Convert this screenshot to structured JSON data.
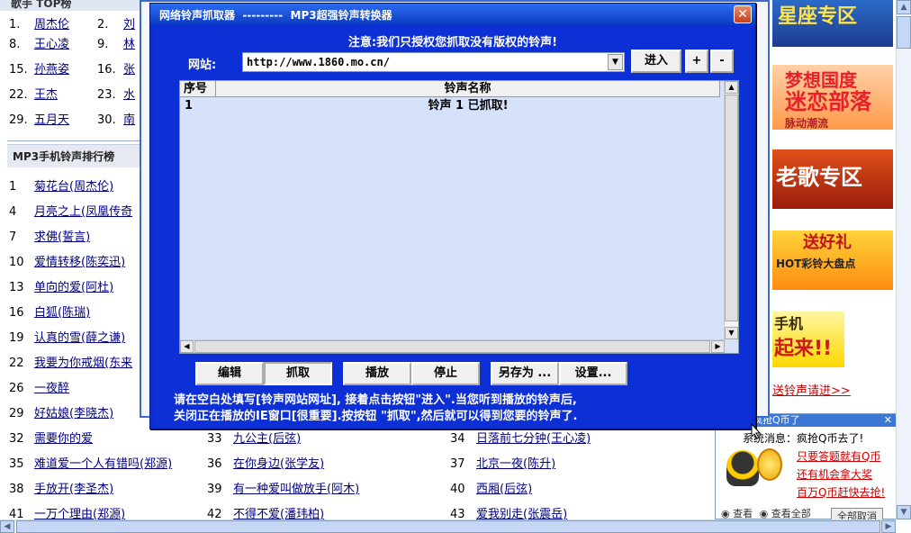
{
  "page": {
    "top_header": "歌手 TOP榜",
    "singers": [
      {
        "num": "1.",
        "name": "周杰伦"
      },
      {
        "num": "2.",
        "name": "刘"
      },
      {
        "num": "8.",
        "name": "王心凌"
      },
      {
        "num": "9.",
        "name": "林"
      },
      {
        "num": "15.",
        "name": "孙燕姿"
      },
      {
        "num": "16.",
        "name": "张"
      },
      {
        "num": "22.",
        "name": "王杰"
      },
      {
        "num": "23.",
        "name": "水"
      },
      {
        "num": "29.",
        "name": "五月天"
      },
      {
        "num": "30.",
        "name": "南"
      }
    ],
    "section_title": "MP3手机铃声排行榜",
    "left_list": [
      {
        "num": "1",
        "title": "菊花台(周杰伦)"
      },
      {
        "num": "4",
        "title": "月亮之上(凤凰传奇"
      },
      {
        "num": "7",
        "title": "求佛(誓言)"
      },
      {
        "num": "10",
        "title": "爱情转移(陈奕迅)"
      },
      {
        "num": "13",
        "title": "单向的爱(阿杜)"
      },
      {
        "num": "16",
        "title": "白狐(陈瑞)"
      },
      {
        "num": "19",
        "title": "认真的雪(薛之谦)"
      },
      {
        "num": "22",
        "title": "我要为你戒烟(东来"
      },
      {
        "num": "26",
        "title": "一夜醉"
      },
      {
        "num": "29",
        "title": "好姑娘(李晓杰)"
      }
    ],
    "bottom_rows": [
      [
        {
          "num": "32",
          "title": "需要你的爱"
        },
        {
          "num": "33",
          "title": "九公主(后弦)"
        },
        {
          "num": "34",
          "title": "日落前七分钟(王心凌)"
        }
      ],
      [
        {
          "num": "35",
          "title": "难道爱一个人有错吗(郑源)"
        },
        {
          "num": "36",
          "title": "在你身边(张学友)"
        },
        {
          "num": "37",
          "title": "北京一夜(陈升)"
        }
      ],
      [
        {
          "num": "38",
          "title": "手放开(李圣杰)"
        },
        {
          "num": "39",
          "title": "有一种爱叫做放手(阿木)"
        },
        {
          "num": "40",
          "title": "西厢(后弦)"
        }
      ],
      [
        {
          "num": "41",
          "title": "一万个理由(郑源)"
        },
        {
          "num": "42",
          "title": "不得不爱(潘玮柏)"
        },
        {
          "num": "43",
          "title": "爱我别走(张震岳)"
        }
      ]
    ],
    "banners": {
      "b1": "星座专区",
      "b2_line1": "梦想国度",
      "b2_line2": "迷恋部落",
      "b2_line3": "脉动潮流",
      "b3": "老歌专区",
      "b4_line1": "送好礼",
      "b4_line2": "HOT彩铃大盘点",
      "b5_line1": "手机",
      "b5_line2": "起来!!"
    },
    "send_link": "送铃声请进>>",
    "msg_panel": {
      "header": "消息：疯抢Q币了",
      "system": "系统消息：疯抢Q币去了!",
      "link1": "只要答题就有Q币",
      "link2": "还有机会拿大奖",
      "link3": "百万Q币赶快去抢!",
      "foot_left": "查看",
      "foot_mid": "查看全部",
      "foot_btn": "全部取消"
    }
  },
  "dialog": {
    "title": "网络铃声抓取器  ---------  MP3超强铃声转换器",
    "notice": "注意:我们只授权您抓取没有版权的铃声!",
    "site_label": "网站:",
    "url": "http://www.1860.mo.cn/",
    "enter_button": "进入",
    "plus_button": "+",
    "minus_button": "-",
    "columns": [
      "序号",
      "铃声名称"
    ],
    "rows": [
      {
        "index": "1",
        "name": "铃声 1 已抓取!"
      }
    ],
    "buttons": {
      "edit": "编辑",
      "grab": "抓取",
      "play": "播放",
      "stop": "停止",
      "save_as": "另存为 ...",
      "settings": "设置..."
    },
    "instructions": [
      "请在空白处填写[铃声网站网址], 接着点击按钮\"进入\".当您听到播放的铃声后,",
      "关闭正在播放的IE窗口[很重要].按按钮 \"抓取\",然后就可以得到您要的铃声了."
    ]
  }
}
